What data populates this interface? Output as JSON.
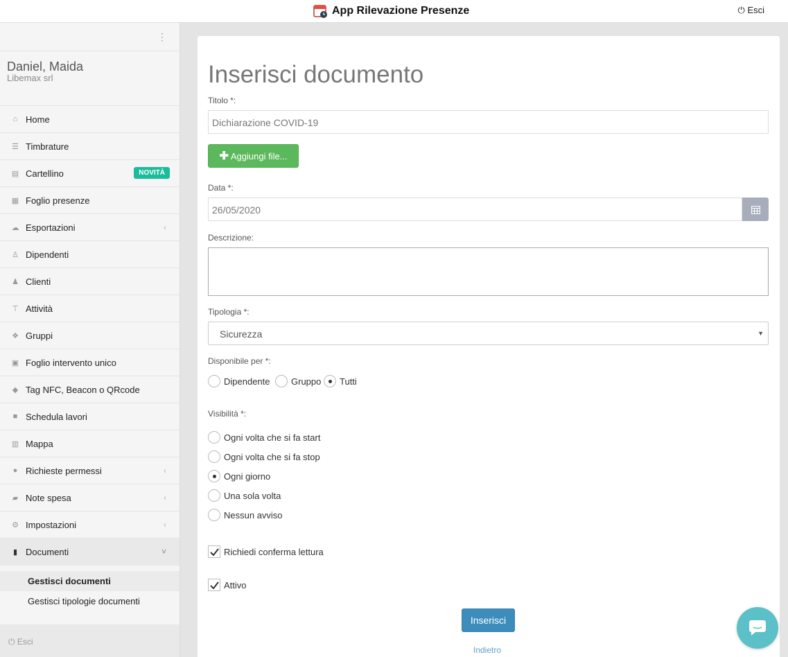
{
  "header": {
    "title": "App Rilevazione Presenze",
    "exit_label": "Esci"
  },
  "user": {
    "name": "Daniel, Maida",
    "company": "Libemax srl"
  },
  "sidebar": {
    "items": [
      {
        "label": "Home",
        "icon": "home-icon"
      },
      {
        "label": "Timbrature",
        "icon": "list-icon"
      },
      {
        "label": "Cartellino",
        "icon": "id-card-icon",
        "badge": "NOVITÀ"
      },
      {
        "label": "Foglio presenze",
        "icon": "table-icon"
      },
      {
        "label": "Esportazioni",
        "icon": "cloud-icon"
      },
      {
        "label": "Dipendenti",
        "icon": "user-icon"
      },
      {
        "label": "Clienti",
        "icon": "users-icon"
      },
      {
        "label": "Attività",
        "icon": "signpost-icon"
      },
      {
        "label": "Gruppi",
        "icon": "cubes-icon"
      },
      {
        "label": "Foglio intervento unico",
        "icon": "document-icon"
      },
      {
        "label": "Tag NFC, Beacon o QRcode",
        "icon": "tags-icon"
      },
      {
        "label": "Schedula lavori",
        "icon": "briefcase-icon"
      },
      {
        "label": "Mappa",
        "icon": "map-icon"
      },
      {
        "label": "Richieste permessi",
        "icon": "comment-icon"
      },
      {
        "label": "Note spesa",
        "icon": "receipt-icon"
      },
      {
        "label": "Impostazioni",
        "icon": "gears-icon"
      },
      {
        "label": "Documenti",
        "icon": "book-icon"
      }
    ],
    "sub_items": [
      {
        "label": "Gestisci documenti"
      },
      {
        "label": "Gestisci tipologie documenti"
      }
    ],
    "footer_label": "Esci"
  },
  "form": {
    "title": "Inserisci documento",
    "titolo_label": "Titolo *:",
    "titolo_value": "Dichiarazione COVID-19",
    "add_file_label": "Aggiungi file...",
    "data_label": "Data *:",
    "data_value": "26/05/2020",
    "descrizione_label": "Descrizione:",
    "descrizione_value": "",
    "tipologia_label": "Tipologia *:",
    "tipologia_value": "Sicurezza",
    "disponibile_label": "Disponibile per *:",
    "disponibile_options": [
      "Dipendente",
      "Gruppo",
      "Tutti"
    ],
    "disponibile_selected": "Tutti",
    "visibilita_label": "Visibilità *:",
    "visibilita_options": [
      "Ogni volta che si fa start",
      "Ogni volta che si fa stop",
      "Ogni giorno",
      "Una sola volta",
      "Nessun avviso"
    ],
    "visibilita_selected": "Ogni giorno",
    "conferma_label": "Richiedi conferma lettura",
    "conferma_checked": true,
    "attivo_label": "Attivo",
    "attivo_checked": true,
    "submit_label": "Inserisci",
    "back_label": "Indietro"
  },
  "colors": {
    "primary": "#3c8dbc",
    "success": "#5cb85c",
    "badge": "#1abc9c",
    "chat": "#5bc0c8"
  }
}
